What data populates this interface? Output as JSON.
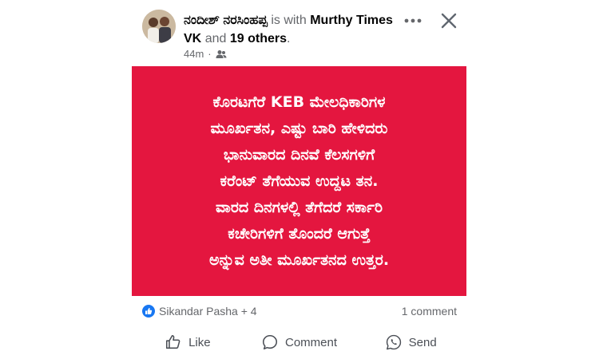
{
  "post": {
    "author_name": "ನಂದೀಶ್ ನರಸಿಂಹಪ್ಪ",
    "with_text": "is with",
    "tagged_name": "Murthy Times VK",
    "and_text": "and",
    "others_text": "19 others",
    "period": ".",
    "timestamp": "44m",
    "separator": "·",
    "audience_icon": "friends-icon",
    "content_lines": [
      "ಕೊರಟಗೆರೆ KEB ಮೇಲಧಿಕಾರಿಗಳ",
      "ಮೂರ್ಖತನ, ಎಷ್ಟು ಬಾರಿ ಹೇಳಿದರು",
      "ಭಾನುವಾರದ ದಿನವೆ ಕೆಲಸಗಳಿಗೆ",
      "ಕರೆಂಟ್ ತೆಗೆಯುವ ಉದ್ದಟ ತನ.",
      "ವಾರದ ದಿನಗಳಲ್ಲಿ ತೆಗೆದರೆ ಸರ್ಕಾರಿ",
      "ಕಚೇರಿಗಳಿಗೆ ತೊಂದರೆ ಆಗುತ್ತೆ",
      "ಅನ್ನುವ ಅತೀ ಮೂರ್ಖತನದ ಉತ್ತರ."
    ],
    "background_color": "#e4163f"
  },
  "reactions": {
    "summary": "Sikandar Pasha + 4",
    "comments": "1 comment",
    "icon": "like-reaction-icon"
  },
  "actions": {
    "like": "Like",
    "comment": "Comment",
    "send": "Send"
  }
}
